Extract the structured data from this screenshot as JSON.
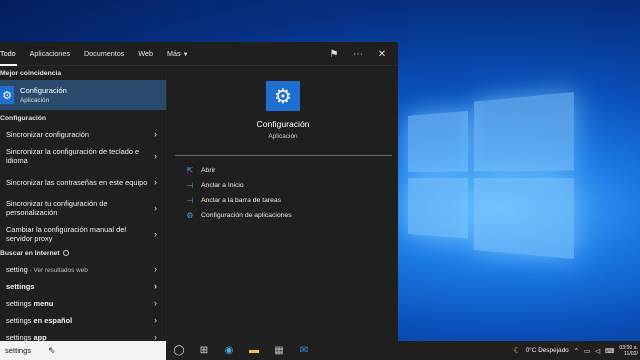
{
  "tabs": [
    {
      "label": "Todo",
      "active": true
    },
    {
      "label": "Aplicaciones"
    },
    {
      "label": "Documentos"
    },
    {
      "label": "Web"
    },
    {
      "label": "Más"
    }
  ],
  "best_match": {
    "header": "Mejor coincidencia",
    "title": "Configuración",
    "subtitle": "Aplicación"
  },
  "settings_section": {
    "header": "Configuración",
    "items": [
      "Sincronizar configuración",
      "Sincronizar la configuración de teclado e idioma",
      "Sincronizar las contraseñas en este equipo",
      "Sincronizar tu configuración de personalización",
      "Cambiar la configuración manual del servidor proxy"
    ]
  },
  "web_section": {
    "header": "Buscar en Internet",
    "items": [
      {
        "bold": "setting",
        "rest": " - Ver resultados web"
      },
      {
        "bold": "settings",
        "rest": ""
      },
      {
        "plain": "settings",
        "bold2": " menu"
      },
      {
        "plain": "settings",
        "bold2": " en español"
      },
      {
        "plain": "settings",
        "bold2": " app"
      }
    ]
  },
  "preview": {
    "title": "Configuración",
    "subtitle": "Aplicación",
    "actions": [
      {
        "label": "Abrir",
        "icon": "open-icon"
      },
      {
        "label": "Anclar a Inicio",
        "icon": "pin-icon"
      },
      {
        "label": "Anclar a la barra de tareas",
        "icon": "pin-taskbar-icon"
      },
      {
        "label": "Configuración de aplicaciones",
        "icon": "gear-icon"
      }
    ]
  },
  "taskbar": {
    "search_value": "settings",
    "weather": "0°C  Despejado",
    "time": "03:00 a.",
    "date": "11/02/"
  },
  "colors": {
    "accent": "#1e6fd0",
    "selected": "#2a4a6d"
  }
}
